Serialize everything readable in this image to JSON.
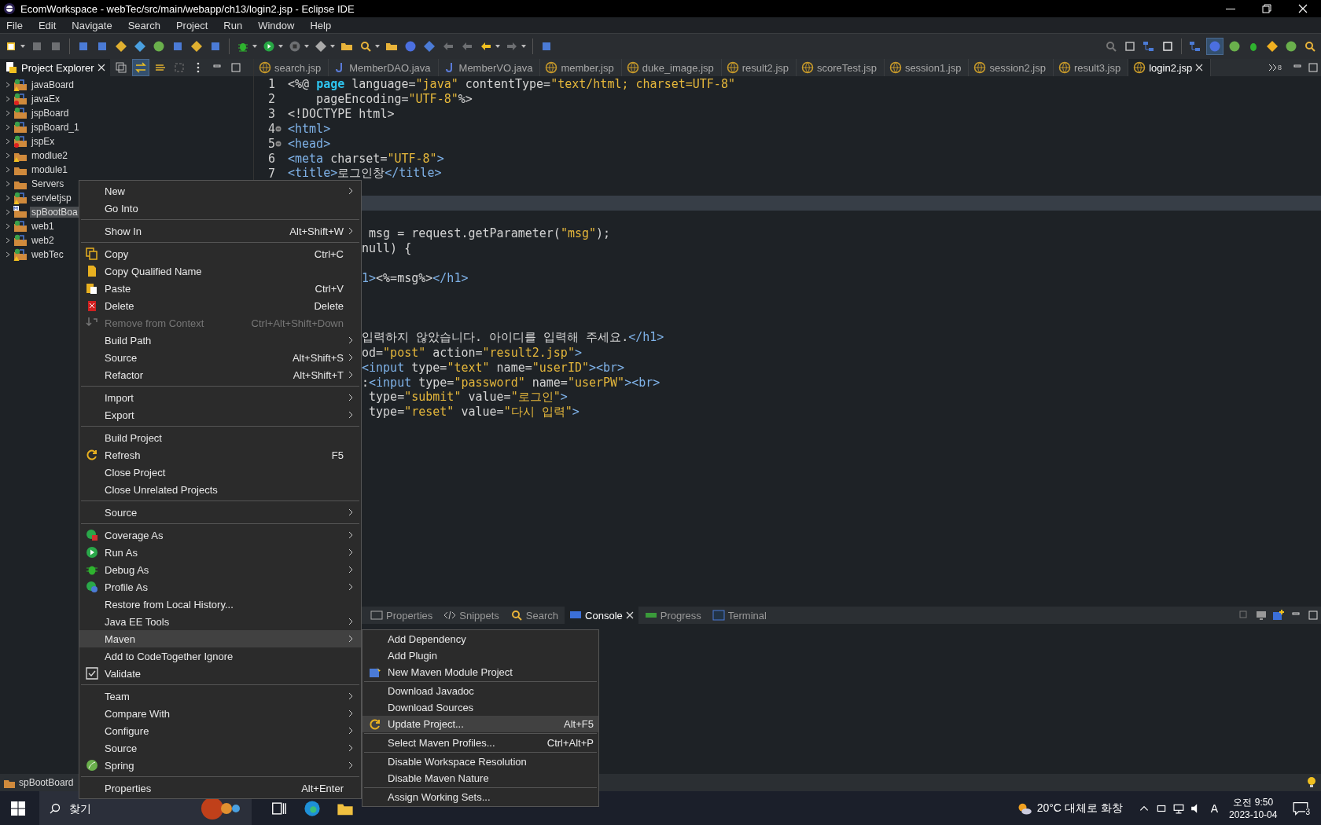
{
  "window": {
    "title": "EcomWorkspace - webTec/src/main/webapp/ch13/login2.jsp - Eclipse IDE"
  },
  "menu_bar": [
    "File",
    "Edit",
    "Navigate",
    "Search",
    "Project",
    "Run",
    "Window",
    "Help"
  ],
  "project_explorer": {
    "title": "Project Explorer",
    "selected": true,
    "items": [
      {
        "label": "javaBoard",
        "kind": "web",
        "warning": true,
        "error": false,
        "expanded": false,
        "selected": false
      },
      {
        "label": "javaEx",
        "kind": "web",
        "warning": false,
        "error": true,
        "expanded": false,
        "selected": false
      },
      {
        "label": "jspBoard",
        "kind": "web",
        "warning": false,
        "error": false,
        "expanded": false,
        "selected": false
      },
      {
        "label": "jspBoard_1",
        "kind": "web",
        "warning": false,
        "error": false,
        "expanded": false,
        "selected": false
      },
      {
        "label": "jspEx",
        "kind": "web",
        "warning": false,
        "error": true,
        "expanded": false,
        "selected": false
      },
      {
        "label": "modlue2",
        "kind": "folder",
        "warning": true,
        "error": false,
        "expanded": false,
        "selected": false
      },
      {
        "label": "module1",
        "kind": "folder",
        "warning": false,
        "error": false,
        "expanded": false,
        "selected": false
      },
      {
        "label": "Servers",
        "kind": "folder",
        "warning": false,
        "error": false,
        "expanded": false,
        "selected": false
      },
      {
        "label": "servletjsp",
        "kind": "web",
        "warning": true,
        "error": false,
        "expanded": false,
        "selected": false
      },
      {
        "label": "spBootBoa",
        "kind": "maven",
        "warning": false,
        "error": false,
        "expanded": false,
        "selected": true
      },
      {
        "label": "web1",
        "kind": "web",
        "warning": false,
        "error": false,
        "expanded": false,
        "selected": false
      },
      {
        "label": "web2",
        "kind": "web",
        "warning": false,
        "error": false,
        "expanded": false,
        "selected": false
      },
      {
        "label": "webTec",
        "kind": "web",
        "warning": true,
        "error": false,
        "expanded": false,
        "selected": false
      }
    ]
  },
  "editor_tabs": [
    {
      "label": "search.jsp",
      "kind": "jsp",
      "selected": false
    },
    {
      "label": "MemberDAO.java",
      "kind": "java",
      "selected": false
    },
    {
      "label": "MemberVO.java",
      "kind": "java",
      "selected": false
    },
    {
      "label": "member.jsp",
      "kind": "jsp",
      "selected": false
    },
    {
      "label": "duke_image.jsp",
      "kind": "jsp",
      "selected": false
    },
    {
      "label": "result2.jsp",
      "kind": "jsp",
      "selected": false
    },
    {
      "label": "scoreTest.jsp",
      "kind": "jsp",
      "selected": false
    },
    {
      "label": "session1.jsp",
      "kind": "jsp",
      "selected": false
    },
    {
      "label": "session2.jsp",
      "kind": "jsp",
      "selected": false
    },
    {
      "label": "result3.jsp",
      "kind": "jsp",
      "selected": false
    },
    {
      "label": "login2.jsp",
      "kind": "jsp",
      "selected": true
    }
  ],
  "hidden_tab_count": "8",
  "code_lines": [
    {
      "number": "1",
      "fold": false,
      "current": false,
      "segments": [
        {
          "kind": "text",
          "text": "<%@ "
        },
        {
          "kind": "keyword",
          "text": "page"
        },
        {
          "kind": "text",
          "text": " language="
        },
        {
          "kind": "string",
          "text": "\"java\""
        },
        {
          "kind": "text",
          "text": " contentType="
        },
        {
          "kind": "string",
          "text": "\"text/html; charset=UTF-8\""
        }
      ]
    },
    {
      "number": "2",
      "fold": false,
      "current": false,
      "segments": [
        {
          "kind": "text",
          "text": "    pageEncoding="
        },
        {
          "kind": "string",
          "text": "\"UTF-8\""
        },
        {
          "kind": "text",
          "text": "%>"
        }
      ]
    },
    {
      "number": "3",
      "fold": false,
      "current": false,
      "segments": [
        {
          "kind": "text",
          "text": "<!DOCTYPE html>"
        }
      ]
    },
    {
      "number": "4",
      "fold": true,
      "current": false,
      "segments": [
        {
          "kind": "tag",
          "text": "<html>"
        }
      ]
    },
    {
      "number": "5",
      "fold": true,
      "current": false,
      "segments": [
        {
          "kind": "tag",
          "text": "<head>"
        }
      ]
    },
    {
      "number": "6",
      "fold": false,
      "current": false,
      "segments": [
        {
          "kind": "tag",
          "text": "<meta "
        },
        {
          "kind": "text",
          "text": "charset="
        },
        {
          "kind": "string",
          "text": "\"UTF-8\""
        },
        {
          "kind": "tag",
          "text": ">"
        }
      ]
    },
    {
      "number": "7",
      "fold": false,
      "current": false,
      "segments": [
        {
          "kind": "tag",
          "text": "<title>"
        },
        {
          "kind": "text",
          "text": "로그인창"
        },
        {
          "kind": "tag",
          "text": "</title>"
        }
      ]
    },
    {
      "fold": false,
      "current": false
    },
    {
      "fold": false,
      "current": true
    },
    {
      "fold": false,
      "current": false
    },
    {
      "fold": false,
      "current": false,
      "segments": [
        {
          "kind": "text",
          "text": " msg = request.getParameter("
        },
        {
          "kind": "string",
          "text": "\"msg\""
        },
        {
          "kind": "text",
          "text": ");"
        }
      ]
    },
    {
      "fold": false,
      "current": false,
      "segments": [
        {
          "kind": "text",
          "text": "null) {"
        }
      ]
    },
    {
      "fold": false,
      "current": false
    },
    {
      "fold": false,
      "current": false,
      "segments": [
        {
          "kind": "tag",
          "text": "1>"
        },
        {
          "kind": "text",
          "text": "<%=msg%>"
        },
        {
          "kind": "tag",
          "text": "</h1>"
        }
      ]
    },
    {
      "fold": false,
      "current": false
    },
    {
      "fold": false,
      "current": false
    },
    {
      "fold": false,
      "current": false
    },
    {
      "fold": false,
      "current": false,
      "segments": [
        {
          "kind": "text",
          "text": "입력하지 않았습니다. 아이디를 입력해 주세요."
        },
        {
          "kind": "tag",
          "text": "</h1>"
        }
      ]
    },
    {
      "fold": false,
      "current": false,
      "segments": [
        {
          "kind": "text",
          "text": "od="
        },
        {
          "kind": "string",
          "text": "\"post\""
        },
        {
          "kind": "text",
          "text": " action="
        },
        {
          "kind": "string",
          "text": "\"result2.jsp\""
        },
        {
          "kind": "tag",
          "text": ">"
        }
      ]
    },
    {
      "fold": false,
      "current": false,
      "segments": [
        {
          "kind": "tag",
          "text": "<input "
        },
        {
          "kind": "text",
          "text": "type="
        },
        {
          "kind": "string",
          "text": "\"text\""
        },
        {
          "kind": "text",
          "text": " name="
        },
        {
          "kind": "string",
          "text": "\"userID\""
        },
        {
          "kind": "tag",
          "text": "><br>"
        }
      ]
    },
    {
      "fold": false,
      "current": false,
      "segments": [
        {
          "kind": "text",
          "text": ":"
        },
        {
          "kind": "tag",
          "text": "<input "
        },
        {
          "kind": "text",
          "text": "type="
        },
        {
          "kind": "string",
          "text": "\"password\""
        },
        {
          "kind": "text",
          "text": " name="
        },
        {
          "kind": "string",
          "text": "\"userPW\""
        },
        {
          "kind": "tag",
          "text": "><br>"
        }
      ]
    },
    {
      "fold": false,
      "current": false,
      "segments": [
        {
          "kind": "text",
          "text": " type="
        },
        {
          "kind": "string",
          "text": "\"submit\""
        },
        {
          "kind": "text",
          "text": " value="
        },
        {
          "kind": "string",
          "text": "\"로그인\""
        },
        {
          "kind": "tag",
          "text": ">"
        }
      ]
    },
    {
      "fold": false,
      "current": false,
      "segments": [
        {
          "kind": "text",
          "text": " type="
        },
        {
          "kind": "string",
          "text": "\"reset\""
        },
        {
          "kind": "text",
          "text": " value="
        },
        {
          "kind": "string",
          "text": "\"다시 입력\""
        },
        {
          "kind": "tag",
          "text": ">"
        }
      ]
    }
  ],
  "bottom_tabs": [
    {
      "label": "Properties",
      "selected": false
    },
    {
      "label": "Snippets",
      "selected": false
    },
    {
      "label": "Search",
      "selected": false
    },
    {
      "label": "Console",
      "selected": true
    },
    {
      "label": "Progress",
      "selected": false
    },
    {
      "label": "Terminal",
      "selected": false
    }
  ],
  "context_menu": [
    {
      "kind": "item",
      "label": "New",
      "submenu": true,
      "disabled": false,
      "selected": false
    },
    {
      "kind": "item",
      "label": "Go Into",
      "submenu": false,
      "disabled": false,
      "selected": false
    },
    {
      "kind": "separator"
    },
    {
      "kind": "item",
      "label": "Show In",
      "shortcut": "Alt+Shift+W",
      "submenu": true,
      "disabled": false,
      "selected": false
    },
    {
      "kind": "separator"
    },
    {
      "kind": "item",
      "label": "Copy",
      "shortcut": "Ctrl+C",
      "submenu": false,
      "disabled": false,
      "selected": false
    },
    {
      "kind": "item",
      "label": "Copy Qualified Name",
      "submenu": false,
      "disabled": false,
      "selected": false
    },
    {
      "kind": "item",
      "label": "Paste",
      "shortcut": "Ctrl+V",
      "submenu": false,
      "disabled": false,
      "selected": false
    },
    {
      "kind": "item",
      "label": "Delete",
      "shortcut": "Delete",
      "submenu": false,
      "disabled": false,
      "selected": false
    },
    {
      "kind": "item",
      "label": "Remove from Context",
      "shortcut": "Ctrl+Alt+Shift+Down",
      "submenu": false,
      "disabled": true,
      "selected": false
    },
    {
      "kind": "item",
      "label": "Build Path",
      "submenu": true,
      "disabled": false,
      "selected": false
    },
    {
      "kind": "item",
      "label": "Source",
      "shortcut": "Alt+Shift+S",
      "submenu": true,
      "disabled": false,
      "selected": false
    },
    {
      "kind": "item",
      "label": "Refactor",
      "shortcut": "Alt+Shift+T",
      "submenu": true,
      "disabled": false,
      "selected": false
    },
    {
      "kind": "separator"
    },
    {
      "kind": "item",
      "label": "Import",
      "submenu": true,
      "disabled": false,
      "selected": false
    },
    {
      "kind": "item",
      "label": "Export",
      "submenu": true,
      "disabled": false,
      "selected": false
    },
    {
      "kind": "separator"
    },
    {
      "kind": "item",
      "label": "Build Project",
      "submenu": false,
      "disabled": false,
      "selected": false
    },
    {
      "kind": "item",
      "label": "Refresh",
      "shortcut": "F5",
      "submenu": false,
      "disabled": false,
      "selected": false
    },
    {
      "kind": "item",
      "label": "Close Project",
      "submenu": false,
      "disabled": false,
      "selected": false
    },
    {
      "kind": "item",
      "label": "Close Unrelated Projects",
      "submenu": false,
      "disabled": false,
      "selected": false
    },
    {
      "kind": "separator"
    },
    {
      "kind": "item",
      "label": "Source",
      "submenu": true,
      "disabled": false,
      "selected": false
    },
    {
      "kind": "separator"
    },
    {
      "kind": "item",
      "label": "Coverage As",
      "submenu": true,
      "disabled": false,
      "selected": false
    },
    {
      "kind": "item",
      "label": "Run As",
      "submenu": true,
      "disabled": false,
      "selected": false
    },
    {
      "kind": "item",
      "label": "Debug As",
      "submenu": true,
      "disabled": false,
      "selected": false
    },
    {
      "kind": "item",
      "label": "Profile As",
      "submenu": true,
      "disabled": false,
      "selected": false
    },
    {
      "kind": "item",
      "label": "Restore from Local History...",
      "submenu": false,
      "disabled": false,
      "selected": false
    },
    {
      "kind": "item",
      "label": "Java EE Tools",
      "submenu": true,
      "disabled": false,
      "selected": false
    },
    {
      "kind": "item",
      "label": "Maven",
      "submenu": true,
      "disabled": false,
      "selected": true
    },
    {
      "kind": "item",
      "label": "Add to CodeTogether Ignore",
      "submenu": false,
      "disabled": false,
      "selected": false
    },
    {
      "kind": "item",
      "label": "Validate",
      "submenu": false,
      "disabled": false,
      "selected": false
    },
    {
      "kind": "separator"
    },
    {
      "kind": "item",
      "label": "Team",
      "submenu": true,
      "disabled": false,
      "selected": false
    },
    {
      "kind": "item",
      "label": "Compare With",
      "submenu": true,
      "disabled": false,
      "selected": false
    },
    {
      "kind": "item",
      "label": "Configure",
      "submenu": true,
      "disabled": false,
      "selected": false
    },
    {
      "kind": "item",
      "label": "Source",
      "submenu": true,
      "disabled": false,
      "selected": false
    },
    {
      "kind": "item",
      "label": "Spring",
      "submenu": true,
      "disabled": false,
      "selected": false
    },
    {
      "kind": "separator"
    },
    {
      "kind": "item",
      "label": "Properties",
      "shortcut": "Alt+Enter",
      "submenu": false,
      "disabled": false,
      "selected": false
    }
  ],
  "maven_submenu": [
    {
      "kind": "item",
      "label": "Add Dependency",
      "selected": false
    },
    {
      "kind": "item",
      "label": "Add Plugin",
      "selected": false
    },
    {
      "kind": "item",
      "label": "New Maven Module Project",
      "selected": false
    },
    {
      "kind": "separator"
    },
    {
      "kind": "item",
      "label": "Download Javadoc",
      "selected": false
    },
    {
      "kind": "item",
      "label": "Download Sources",
      "selected": false
    },
    {
      "kind": "item",
      "label": "Update Project...",
      "shortcut": "Alt+F5",
      "selected": true
    },
    {
      "kind": "separator"
    },
    {
      "kind": "item",
      "label": "Select Maven Profiles...",
      "shortcut": "Ctrl+Alt+P",
      "selected": false
    },
    {
      "kind": "separator"
    },
    {
      "kind": "item",
      "label": "Disable Workspace Resolution",
      "selected": false
    },
    {
      "kind": "item",
      "label": "Disable Maven Nature",
      "selected": false
    },
    {
      "kind": "separator"
    },
    {
      "kind": "item",
      "label": "Assign Working Sets...",
      "selected": false
    }
  ],
  "status_bar": {
    "text": "spBootBoard"
  },
  "taskbar": {
    "search": {
      "placeholder": "찾기"
    },
    "weather": "20°C 대체로 화창",
    "ime": "A",
    "time": "오전 9:50",
    "date": "2023-10-04",
    "notifications": "3"
  }
}
